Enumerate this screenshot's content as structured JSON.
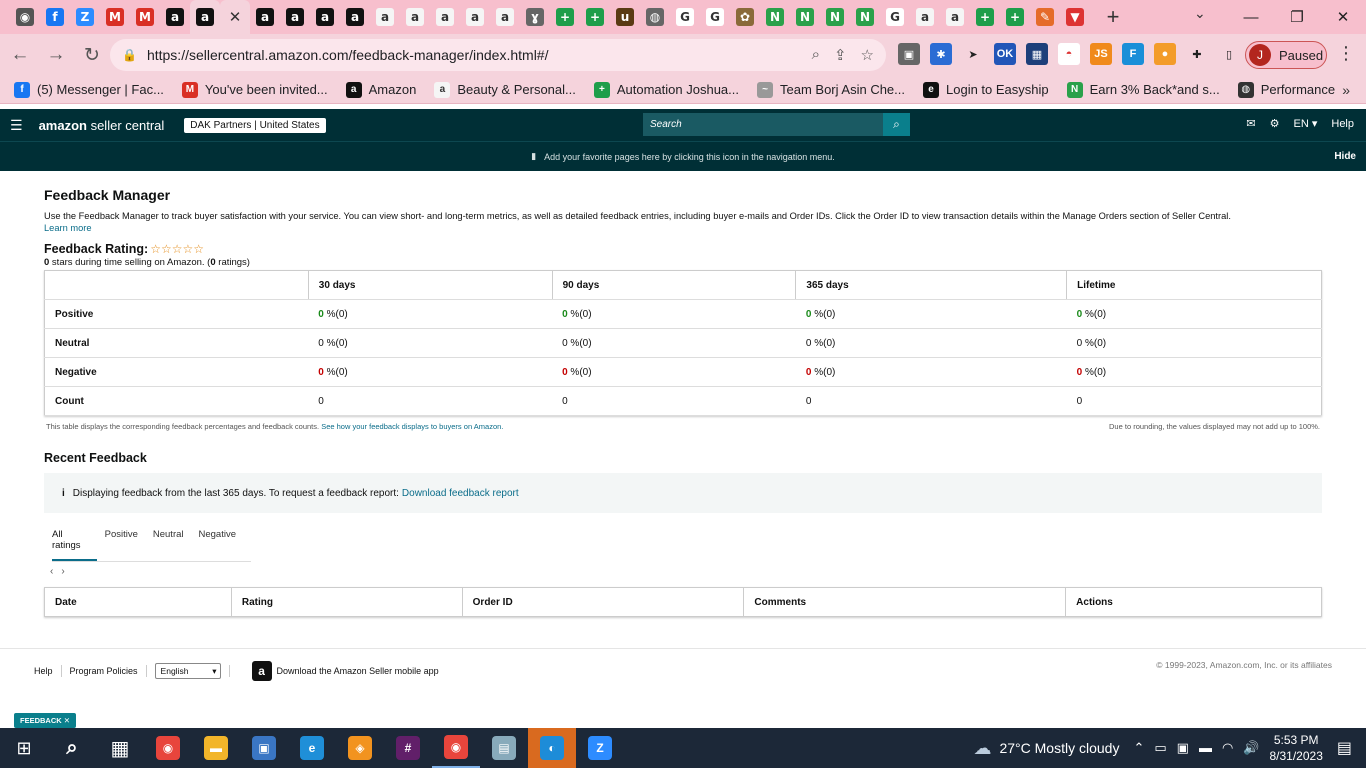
{
  "browser": {
    "tabs": [
      {
        "icon": "chrome-icon",
        "color": "#555",
        "glyph": "◉"
      },
      {
        "icon": "facebook-icon",
        "color": "#1877f2",
        "glyph": "f"
      },
      {
        "icon": "zoom-icon",
        "color": "#2d8cff",
        "glyph": "Z"
      },
      {
        "icon": "gmail-icon",
        "color": "#d93025",
        "glyph": "M"
      },
      {
        "icon": "gmail-icon",
        "color": "#d93025",
        "glyph": "M"
      },
      {
        "icon": "amazon-icon",
        "color": "#111",
        "glyph": "a"
      },
      {
        "icon": "amazon-icon",
        "color": "#111",
        "glyph": "a"
      },
      {
        "icon": "amazon-icon",
        "color": "#111",
        "glyph": "a"
      },
      {
        "icon": "amazon-icon",
        "color": "#111",
        "glyph": "a"
      },
      {
        "icon": "amazon-icon",
        "color": "#111",
        "glyph": "a"
      },
      {
        "icon": "amazon-icon",
        "color": "#111",
        "glyph": "a"
      },
      {
        "icon": "amazon-smile-icon",
        "color": "#f5f5f5",
        "glyph": "a"
      },
      {
        "icon": "amazon-smile-icon",
        "color": "#f5f5f5",
        "glyph": "a"
      },
      {
        "icon": "amazon-smile-icon",
        "color": "#f5f5f5",
        "glyph": "a"
      },
      {
        "icon": "amazon-smile-icon",
        "color": "#f5f5f5",
        "glyph": "a"
      },
      {
        "icon": "amazon-smile-icon",
        "color": "#f5f5f5",
        "glyph": "a"
      },
      {
        "icon": "tool-icon",
        "color": "#666",
        "glyph": "ɣ"
      },
      {
        "icon": "sheets-icon",
        "color": "#1e9e4a",
        "glyph": "+"
      },
      {
        "icon": "sheets-icon",
        "color": "#1e9e4a",
        "glyph": "+"
      },
      {
        "icon": "ups-icon",
        "color": "#5a3a13",
        "glyph": "u"
      },
      {
        "icon": "globe-icon",
        "color": "#666",
        "glyph": "◍"
      },
      {
        "icon": "google-icon",
        "color": "#fff",
        "glyph": "G"
      },
      {
        "icon": "google-icon",
        "color": "#fff",
        "glyph": "G"
      },
      {
        "icon": "plant-icon",
        "color": "#8a6a3a",
        "glyph": "✿"
      },
      {
        "icon": "n-icon",
        "color": "#2aa14a",
        "glyph": "N"
      },
      {
        "icon": "n-icon",
        "color": "#2aa14a",
        "glyph": "N"
      },
      {
        "icon": "n-icon",
        "color": "#2aa14a",
        "glyph": "N"
      },
      {
        "icon": "n-icon",
        "color": "#2aa14a",
        "glyph": "N"
      },
      {
        "icon": "google-icon",
        "color": "#fff",
        "glyph": "G"
      },
      {
        "icon": "amazon-smile-icon",
        "color": "#f5f5f5",
        "glyph": "a"
      },
      {
        "icon": "amazon-smile-icon",
        "color": "#f5f5f5",
        "glyph": "a"
      },
      {
        "icon": "sheets-icon",
        "color": "#1e9e4a",
        "glyph": "+"
      },
      {
        "icon": "sheets-icon",
        "color": "#1e9e4a",
        "glyph": "+"
      },
      {
        "icon": "pen-icon",
        "color": "#e56b2a",
        "glyph": "✎"
      },
      {
        "icon": "flag-icon",
        "color": "#d33",
        "glyph": "▼"
      }
    ],
    "active_tab_index": 6,
    "url": "https://sellercentral.amazon.com/feedback-manager/index.html#/",
    "profile_initial": "J",
    "profile_status": "Paused",
    "bookmarks": [
      {
        "label": "(5) Messenger | Fac...",
        "icon": "facebook-icon",
        "color": "#1877f2",
        "glyph": "f"
      },
      {
        "label": "You've been invited...",
        "icon": "gmail-icon",
        "color": "#d93025",
        "glyph": "M"
      },
      {
        "label": "Amazon",
        "icon": "amazon-icon",
        "color": "#111",
        "glyph": "a"
      },
      {
        "label": "Beauty & Personal...",
        "icon": "amazon-smile-icon",
        "color": "#f5f5f5",
        "glyph": "a"
      },
      {
        "label": "Automation Joshua...",
        "icon": "sheets-icon",
        "color": "#1e9e4a",
        "glyph": "+"
      },
      {
        "label": "Team Borj Asin Che...",
        "icon": "tool-icon",
        "color": "#999",
        "glyph": "~"
      },
      {
        "label": "Login to Easyship",
        "icon": "easyship-icon",
        "color": "#111",
        "glyph": "e"
      },
      {
        "label": "Earn 3% Back*and s...",
        "icon": "n-icon",
        "color": "#2aa14a",
        "glyph": "N"
      },
      {
        "label": "Performance",
        "icon": "globe-icon",
        "color": "#333",
        "glyph": "◍"
      }
    ]
  },
  "seller_central": {
    "logo_bold": "amazon",
    "logo_rest": " seller central",
    "account": "DAK Partners | United States",
    "search_placeholder": "Search",
    "language": "EN",
    "help": "Help",
    "notice": "Add your favorite pages here by clicking this icon in the navigation menu.",
    "hide": "Hide"
  },
  "page": {
    "title": "Feedback Manager",
    "description": "Use the Feedback Manager to track buyer satisfaction with your service. You can view short- and long-term metrics, as well as detailed feedback entries, including buyer e-mails and Order IDs. Click the Order ID to view transaction details within the Manage Orders section of Seller Central.",
    "learn_more": "Learn more",
    "rating_label": "Feedback Rating:",
    "stars": 0,
    "stars_max": 5,
    "stars_count": "0",
    "stars_suffix": " stars during time selling on Amazon. (",
    "ratings_count": "0",
    "ratings_suffix": " ratings)",
    "metrics_columns": [
      "30 days",
      "90 days",
      "365 days",
      "Lifetime"
    ],
    "metrics_rows": [
      {
        "label": "Positive",
        "cls": "g",
        "values": [
          [
            "0",
            " %(0)"
          ],
          [
            "0",
            " %(0)"
          ],
          [
            "0",
            " %(0)"
          ],
          [
            "0",
            " %(0)"
          ]
        ]
      },
      {
        "label": "Neutral",
        "cls": "",
        "values": [
          [
            "0",
            " %(0)"
          ],
          [
            "0",
            " %(0)"
          ],
          [
            "0",
            " %(0)"
          ],
          [
            "0",
            " %(0)"
          ]
        ]
      },
      {
        "label": "Negative",
        "cls": "r",
        "values": [
          [
            "0",
            " %(0)"
          ],
          [
            "0",
            " %(0)"
          ],
          [
            "0",
            " %(0)"
          ],
          [
            "0",
            " %(0)"
          ]
        ]
      },
      {
        "label": "Count",
        "cls": "",
        "values": [
          [
            "0",
            ""
          ],
          [
            "0",
            ""
          ],
          [
            "0",
            ""
          ],
          [
            "0",
            ""
          ]
        ]
      }
    ],
    "table_note_left": "This table displays the corresponding feedback percentages and feedback counts. See how your feedback displays to buyers on Amazon.",
    "table_note_right": "Due to rounding, the values displayed may not add up to 100%.",
    "recent_title": "Recent Feedback",
    "info_text": "Displaying feedback from the last 365 days. To request a feedback report: ",
    "info_link": "Download feedback report",
    "filter_tabs": [
      "All ratings",
      "Positive",
      "Neutral",
      "Negative"
    ],
    "recent_columns": [
      "Date",
      "Rating",
      "Order ID",
      "Comments",
      "Actions"
    ]
  },
  "footer": {
    "help": "Help",
    "policies": "Program Policies",
    "language": "English",
    "app_text": "Download the Amazon Seller mobile app",
    "copyright": "© 1999-2023, Amazon.com, Inc. or its affiliates",
    "feedback": "FEEDBACK"
  },
  "taskbar": {
    "apps": [
      {
        "icon": "search-icon",
        "glyph": "⌕",
        "color": "transparent"
      },
      {
        "icon": "task-view-icon",
        "glyph": "▦",
        "color": "transparent"
      },
      {
        "icon": "chrome-icon",
        "glyph": "◉",
        "color": "#e8453c"
      },
      {
        "icon": "file-explorer-icon",
        "glyph": "▬",
        "color": "#f2b52a"
      },
      {
        "icon": "computer-icon",
        "glyph": "▣",
        "color": "#3a76c4"
      },
      {
        "icon": "edge-icon",
        "glyph": "e",
        "color": "#1f8fd8"
      },
      {
        "icon": "brave-icon",
        "glyph": "◈",
        "color": "#f2931f"
      },
      {
        "icon": "slack-icon",
        "glyph": "#",
        "color": "#611f69"
      },
      {
        "icon": "chrome-profile-icon",
        "glyph": "◉",
        "color": "#e8453c"
      },
      {
        "icon": "sheet-app-icon",
        "glyph": "▤",
        "color": "#8ab"
      },
      {
        "icon": "feedback-app-icon",
        "glyph": "◐",
        "color": "#1d8cd8"
      },
      {
        "icon": "zoom-icon",
        "glyph": "Z",
        "color": "#2d8cff"
      }
    ],
    "weather_temp": "27°C",
    "weather_text": "Mostly cloudy",
    "time": "5:53 PM",
    "date": "8/31/2023"
  }
}
